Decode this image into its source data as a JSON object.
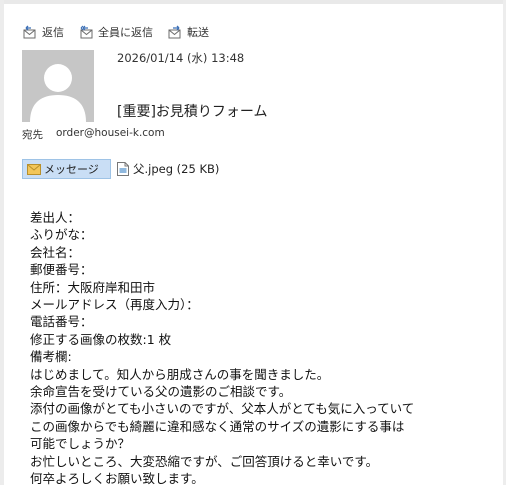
{
  "toolbar": {
    "reply": "返信",
    "reply_all": "全員に返信",
    "forward": "転送"
  },
  "header": {
    "date": "2026/01/14 (水) 13:48",
    "subject": "[重要]お見積りフォーム",
    "to_label": "宛先",
    "to_address": "order@housei-k.com"
  },
  "attachments": {
    "message_tab": "メッセージ",
    "file": "父.jpeg (25 KB)"
  },
  "body": {
    "lines": [
      "差出人：",
      "ふりがな：",
      "会社名：",
      "郵便番号：",
      "住所：大阪府岸和田市",
      "メールアドレス（再度入力）：",
      "電話番号：",
      "修正する画像の枚数:1 枚",
      "備考欄:",
      "はじめまして。知人から朋成さんの事を聞きました。",
      "余命宣告を受けている父の遺影のご相談です。",
      "添付の画像がとても小さいのですが、父本人がとても気に入っていて",
      "この画像からでも綺麗に違和感なく通常のサイズの遺影にする事は",
      "可能でしょうか？",
      "お忙しいところ、大変恐縮ですが、ご回答頂けると幸いです。",
      "何卒よろしくお願い致します。"
    ]
  }
}
